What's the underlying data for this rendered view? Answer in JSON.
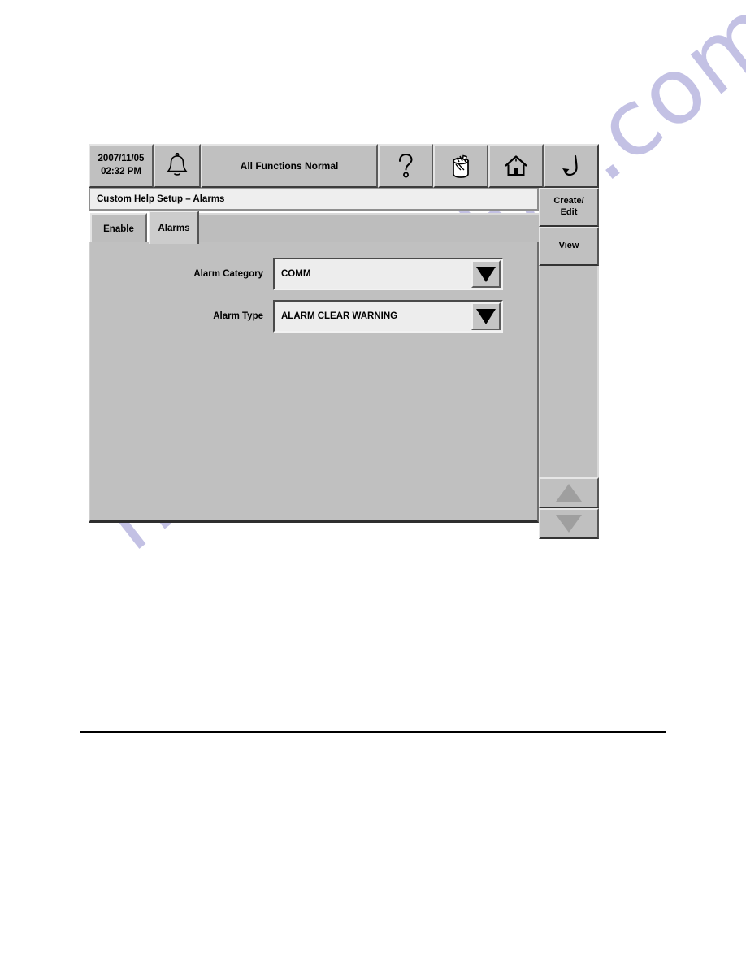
{
  "toolbar": {
    "datetime": {
      "date": "2007/11/05",
      "time": "02:32 PM"
    },
    "alarm_icon": "bell-icon",
    "status": "All Functions Normal",
    "help_icon": "question-mark-icon",
    "supplies_icon": "supplies-cartridge-icon",
    "home_icon": "home-icon",
    "back_icon": "return-arrow-icon"
  },
  "titlebar": {
    "title": "Custom Help Setup – Alarms"
  },
  "tabs": [
    {
      "label": "Enable",
      "active": false
    },
    {
      "label": "Alarms",
      "active": true
    }
  ],
  "form": {
    "fields": [
      {
        "label": "Alarm Category",
        "value": "COMM",
        "dropdown_icon": "triangle-down-icon"
      },
      {
        "label": "Alarm Type",
        "value": "ALARM CLEAR WARNING",
        "dropdown_icon": "triangle-down-icon"
      }
    ]
  },
  "sidebar": {
    "buttons": [
      {
        "label": "Create/\nEdit",
        "line1": "Create/",
        "line2": "Edit"
      },
      {
        "label": "View",
        "line1": "View",
        "line2": ""
      }
    ],
    "scroll_up_icon": "triangle-up-icon",
    "scroll_down_icon": "triangle-down-icon"
  },
  "watermark": {
    "text": "manualshive.com"
  },
  "colors": {
    "panel_gray": "#c0c0c0",
    "field_bg": "#ededed",
    "titlebar_bg": "#eeeeee",
    "active_tab_bg": "#cccccc",
    "text": "#000000",
    "link": "#1a1a8c",
    "watermark": "#b9b7e0"
  }
}
